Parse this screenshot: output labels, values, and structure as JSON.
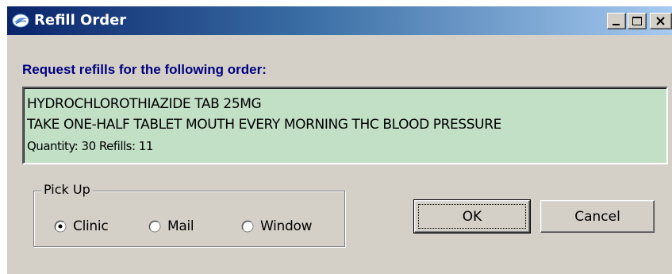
{
  "window": {
    "title": "Refill Order"
  },
  "heading": "Request refills for the following order:",
  "order": {
    "drug": "HYDROCHLOROTHIAZIDE TAB  25MG",
    "sig": "TAKE ONE-HALF TABLET MOUTH EVERY MORNING THC BLOOD PRESSURE",
    "quantity_refills": "Quantity: 30 Refills: 11",
    "background_color": "#c2e0c6"
  },
  "pickup": {
    "legend": "Pick Up",
    "options": [
      {
        "label": "Clinic",
        "selected": true
      },
      {
        "label": "Mail",
        "selected": false
      },
      {
        "label": "Window",
        "selected": false
      }
    ]
  },
  "buttons": {
    "ok": "OK",
    "cancel": "Cancel"
  },
  "colors": {
    "titlebar_start": "#0a246a",
    "titlebar_end": "#a6caf0",
    "heading": "#000080",
    "dialog_bg": "#d4d0c8"
  }
}
